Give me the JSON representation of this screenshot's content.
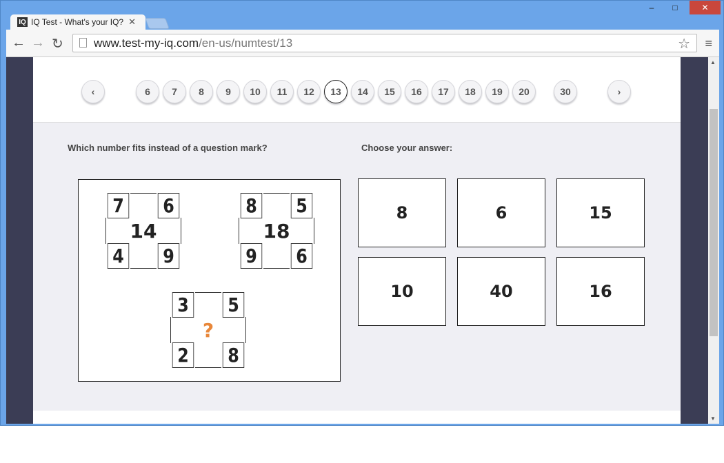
{
  "browser": {
    "tab_title": "IQ Test - What's your IQ?",
    "tab_logo": "IQ",
    "url_host": "www.test-my-iq.com",
    "url_path": "/en-us/numtest/13"
  },
  "pagination": {
    "prev": "‹",
    "next": "›",
    "pages": [
      "6",
      "7",
      "8",
      "9",
      "10",
      "11",
      "12",
      "13",
      "14",
      "15",
      "16",
      "17",
      "18",
      "19",
      "20",
      "30"
    ],
    "current": "13"
  },
  "question": {
    "prompt": "Which number fits instead of a question mark?",
    "answer_prompt": "Choose your answer:"
  },
  "puzzle": [
    {
      "tl": "7",
      "tr": "6",
      "bl": "4",
      "br": "9",
      "center": "14"
    },
    {
      "tl": "8",
      "tr": "5",
      "bl": "9",
      "br": "6",
      "center": "18"
    },
    {
      "tl": "3",
      "tr": "5",
      "bl": "2",
      "br": "8",
      "center": "?"
    }
  ],
  "answers": [
    "8",
    "6",
    "15",
    "10",
    "40",
    "16"
  ],
  "colors": {
    "question_mark": "#e8873a",
    "frame": "#6ba5e9"
  }
}
